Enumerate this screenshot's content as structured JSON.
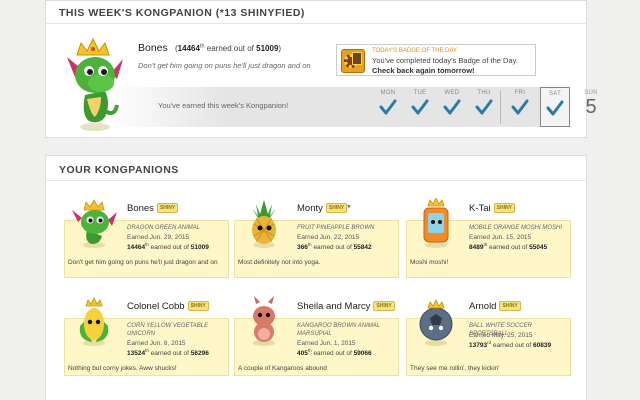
{
  "top": {
    "title": "THIS WEEK'S KONGPANION (*13 SHINYFIED)",
    "hero": {
      "name": "Bones",
      "score": "14464",
      "score_suffix": "th",
      "earned_text": "earned out of",
      "total": "51009",
      "quote": "Don't get him going on puns he'll just dragon and on"
    },
    "badge": {
      "kicker": "TODAY'S BADGE OF THE DAY",
      "text": "You've completed today's Badge of the Day.",
      "link": "Check back again tomorrow!"
    },
    "week": {
      "label": "You've earned this week's Kongpanion!",
      "days": [
        "MON",
        "TUE",
        "WED",
        "THU",
        "FRI",
        "SAT",
        "SUN"
      ],
      "remaining": "5"
    }
  },
  "bottom": {
    "title": "YOUR KONGPANIONS",
    "shiny_label": "SHINY",
    "cards": [
      {
        "name": "Bones",
        "shiny": true,
        "star": "",
        "type": "DRAGON GREEN ANIMAL",
        "earned": "Earned Jun. 29, 2015",
        "score": "14464",
        "suffix": "th",
        "out_of": "earned out of",
        "total": "51009",
        "quote": "Don't get him going on puns he'll just dragon and on"
      },
      {
        "name": "Monty",
        "shiny": true,
        "star": "*",
        "type": "FRUIT PINEAPPLE BROWN",
        "earned": "Earned Jun. 22, 2015",
        "score": "366",
        "suffix": "th",
        "out_of": "earned out of",
        "total": "55842",
        "quote": "Most definitely not into yoga."
      },
      {
        "name": "K-Tai",
        "shiny": true,
        "star": "",
        "type": "MOBILE ORANGE MOSHI MOSHI",
        "earned": "Earned Jun. 15, 2015",
        "score": "8489",
        "suffix": "th",
        "out_of": "earned out of",
        "total": "55045",
        "quote": "Moshi moshi!"
      },
      {
        "name": "Colonel Cobb",
        "shiny": true,
        "star": "",
        "type": "CORN YELLOW VEGETABLE UNICORN",
        "earned": "Earned Jun. 8, 2015",
        "score": "13524",
        "suffix": "th",
        "out_of": "earned out of",
        "total": "56296",
        "quote": "Nothing but corny jokes. Aww shucks!"
      },
      {
        "name": "Sheila and Marcy",
        "shiny": true,
        "star": "",
        "type": "KANGAROO BROWN ANIMAL MARSUPIAL",
        "earned": "Earned Jun. 1, 2015",
        "score": "405",
        "suffix": "th",
        "out_of": "earned out of",
        "total": "59066",
        "quote": "A couple of Kangaroos abound"
      },
      {
        "name": "Arnold",
        "shiny": true,
        "star": "",
        "type": "BALL WHITE SOCCER SPORTSBALL",
        "earned": "Earned May. 25, 2015",
        "score": "13793",
        "suffix": "rd",
        "out_of": "earned out of",
        "total": "60839",
        "quote": "They see me rollin', they kickin'"
      }
    ]
  }
}
